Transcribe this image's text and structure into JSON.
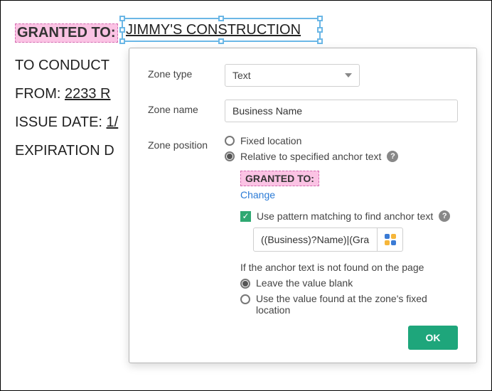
{
  "document": {
    "granted_to_label": "GRANTED TO:",
    "business_name": "JIMMY'S CONSTRUCTION",
    "line_conduct_prefix": "TO CONDUCT ",
    "line_from_prefix": "FROM: ",
    "line_from_value": "2233 R",
    "line_issue_prefix": "ISSUE DATE: ",
    "line_issue_value": "1/",
    "line_expiration": "EXPIRATION D"
  },
  "popover": {
    "zone_type_label": "Zone type",
    "zone_type_value": "Text",
    "zone_name_label": "Zone name",
    "zone_name_value": "Business Name",
    "zone_position_label": "Zone position",
    "position_fixed": "Fixed location",
    "position_relative": "Relative to specified anchor text",
    "anchor_text_value": "GRANTED TO:",
    "change_link": "Change",
    "use_pattern_label": "Use pattern matching to find anchor text",
    "pattern_value": "((Business)?Name)|(Gran",
    "not_found_heading": "If the anchor text is not found on the page",
    "not_found_leave_blank": "Leave the value blank",
    "not_found_use_fixed": "Use the value found at the zone's fixed location",
    "ok_label": "OK"
  }
}
